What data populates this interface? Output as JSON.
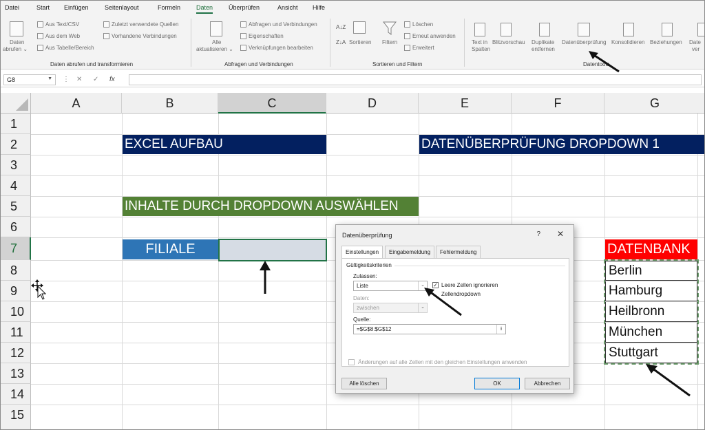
{
  "menu_tabs": [
    "Datei",
    "Start",
    "Einfügen",
    "Seitenlayout",
    "Formeln",
    "Daten",
    "Überprüfen",
    "Ansicht",
    "Hilfe"
  ],
  "active_tab": "Daten",
  "ribbon": {
    "get_data": {
      "line1": "Daten",
      "line2": "abrufen ⌄"
    },
    "from_text_csv": "Aus Text/CSV",
    "from_web": "Aus dem Web",
    "from_table": "Aus Tabelle/Bereich",
    "recent_sources": "Zuletzt verwendete Quellen",
    "existing_connections": "Vorhandene Verbindungen",
    "group_get_transform": "Daten abrufen und transformieren",
    "refresh_all": {
      "line1": "Alle",
      "line2": "aktualisieren ⌄"
    },
    "queries_connections": "Abfragen und Verbindungen",
    "properties": "Eigenschaften",
    "edit_links": "Verknüpfungen bearbeiten",
    "group_queries": "Abfragen und Verbindungen",
    "sort_az": "A↓Z",
    "sort_za": "Z↓A",
    "sort": "Sortieren",
    "filter": "Filtern",
    "clear": "Löschen",
    "reapply": "Erneut anwenden",
    "advanced": "Erweitert",
    "group_sort_filter": "Sortieren und Filtern",
    "text_to_columns": {
      "line1": "Text in",
      "line2": "Spalten"
    },
    "flash_fill": "Blitzvorschau",
    "remove_duplicates": {
      "line1": "Duplikate",
      "line2": "entfernen"
    },
    "data_validation": "Datenüberprüfung",
    "consolidate": "Konsolidieren",
    "relationships": "Beziehungen",
    "data_model": {
      "line1": "Date",
      "line2": "ver"
    },
    "group_data_tools": "Datentools"
  },
  "formula_bar": {
    "name_box": "G8",
    "cancel_icon": "✕",
    "enter_icon": "✓",
    "fx_icon": "fx",
    "content": ""
  },
  "columns": [
    "A",
    "B",
    "C",
    "D",
    "E",
    "F",
    "G"
  ],
  "selected_column": "C",
  "rows": [
    "1",
    "2",
    "3",
    "4",
    "5",
    "6",
    "7",
    "8",
    "9",
    "10",
    "11",
    "12",
    "13",
    "14",
    "15"
  ],
  "selected_row": "7",
  "cells": {
    "B2": "EXCEL AUFBAU",
    "E2": "DATENÜBERPRÜFUNG DROPDOWN 1",
    "B5": "INHALTE DURCH DROPDOWN AUSWÄHLEN",
    "B7": "FILIALE",
    "C7": "",
    "G7": "DATENBANK",
    "G8": "Berlin",
    "G9": "Hamburg",
    "G10": "Heilbronn",
    "G11": "München",
    "G12": "Stuttgart"
  },
  "colors": {
    "navy": "#032060",
    "green": "#538135",
    "blue": "#2e75b6",
    "red": "#ff0000",
    "selection_fill": "#d6dce4",
    "excel_green": "#217346"
  },
  "dialog": {
    "title": "Datenüberprüfung",
    "help": "?",
    "close": "✕",
    "tabs": [
      "Einstellungen",
      "Eingabemeldung",
      "Fehlermeldung"
    ],
    "active_tab": "Einstellungen",
    "section": "Gültigkeitskriterien",
    "allow_label": "Zulassen:",
    "allow_value": "Liste",
    "ignore_blank": "Leere Zellen ignorieren",
    "ignore_blank_checked": true,
    "in_cell_dropdown": "Zellendropdown",
    "in_cell_dropdown_checked": true,
    "data_label": "Daten:",
    "data_value": "zwischen",
    "source_label": "Quelle:",
    "source_value": "=$G$8:$G$12",
    "apply_all": "Änderungen auf alle Zellen mit den gleichen Einstellungen anwenden",
    "clear_all": "Alle löschen",
    "ok": "OK",
    "cancel": "Abbrechen"
  }
}
